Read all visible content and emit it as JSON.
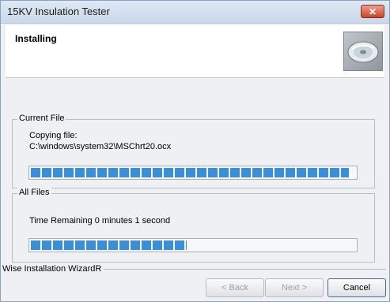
{
  "window": {
    "title": "15KV Insulation Tester",
    "close_label": "✕"
  },
  "header": {
    "title": "Installing",
    "icon": "cd-disc-icon"
  },
  "current_file": {
    "group_label": "Current File",
    "status_line": "Copying file:",
    "path": "C:\\windows\\system32\\MSChrt20.ocx",
    "progress": 0.98
  },
  "all_files": {
    "group_label": "All Files",
    "time_remaining": "Time Remaining 0 minutes 1 second",
    "progress": 0.48
  },
  "footer": {
    "label": "Wise Installation WizardR",
    "back_label": "< Back",
    "next_label": "Next >",
    "cancel_label": "Cancel"
  }
}
